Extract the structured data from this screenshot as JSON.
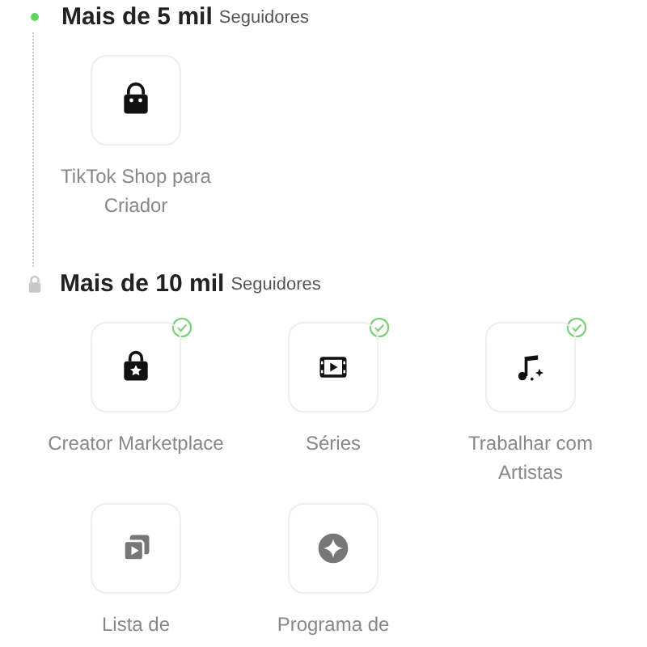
{
  "sections": [
    {
      "title": "Mais de 5 mil",
      "subtitle": "Seguidores",
      "unlocked": true,
      "items": [
        {
          "label": "TikTok Shop para Criador",
          "checked": false,
          "disabled": false
        }
      ]
    },
    {
      "title": "Mais de 10 mil",
      "subtitle": "Seguidores",
      "unlocked": false,
      "items": [
        {
          "label": "Creator Marketplace",
          "checked": true,
          "disabled": false
        },
        {
          "label": "Séries",
          "checked": true,
          "disabled": false
        },
        {
          "label": "Trabalhar com Artistas",
          "checked": true,
          "disabled": false
        },
        {
          "label": "Lista de",
          "checked": false,
          "disabled": true
        },
        {
          "label": "Programa de",
          "checked": false,
          "disabled": true
        }
      ]
    }
  ]
}
